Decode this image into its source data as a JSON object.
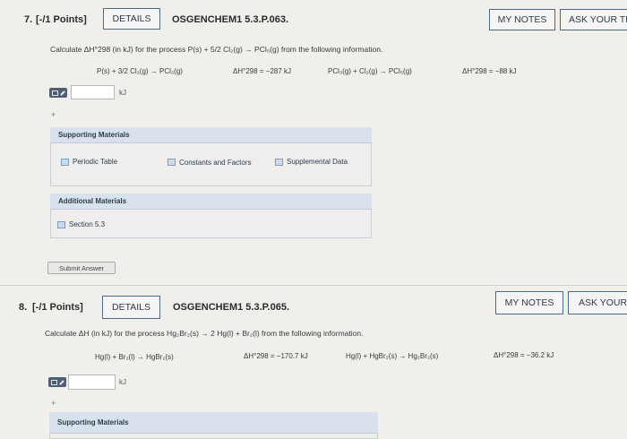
{
  "q7": {
    "number": "7.",
    "points": "[-/1 Points]",
    "details": "DETAILS",
    "code": "OSGENCHEM1 5.3.P.063.",
    "my_notes": "MY NOTES",
    "ask": "ASK YOUR TE",
    "prompt": "Calculate ΔH°298 (in kJ) for the process P(s) + 5/2 Cl₂(g) → PCl₅(g) from the following information.",
    "eq1": "P(s) + 3/2 Cl₂(g) → PCl₃(g)",
    "dh1": "ΔH°298 = −287 kJ",
    "eq2": "PCl₃(g) + Cl₂(g) → PCl₅(g)",
    "dh2": "ΔH°298 = −88 kJ",
    "unit": "kJ",
    "plus": "+",
    "supporting_title": "Supporting Materials",
    "resources": [
      "Periodic Table",
      "Constants and Factors",
      "Supplemental Data"
    ],
    "additional_title": "Additional Materials",
    "section": "Section 5.3",
    "submit": "Submit Answer"
  },
  "q8": {
    "number": "8.",
    "points": "[-/1 Points]",
    "details": "DETAILS",
    "code": "OSGENCHEM1 5.3.P.065.",
    "my_notes": "MY NOTES",
    "ask": "ASK YOUR",
    "prompt": "Calculate ΔH (in kJ) for the process Hg₂Br₂(s) → 2 Hg(l) + Br₂(l) from the following information.",
    "eq1": "Hg(l) + Br₂(l) → HgBr₂(s)",
    "dh1": "ΔH°298 = −170.7 kJ",
    "eq2": "Hg(l) + HgBr₂(s) → Hg₂Br₂(s)",
    "dh2": "ΔH°298 = −36.2 kJ",
    "unit": "kJ",
    "plus": "+",
    "supporting_title": "Supporting Materials"
  }
}
